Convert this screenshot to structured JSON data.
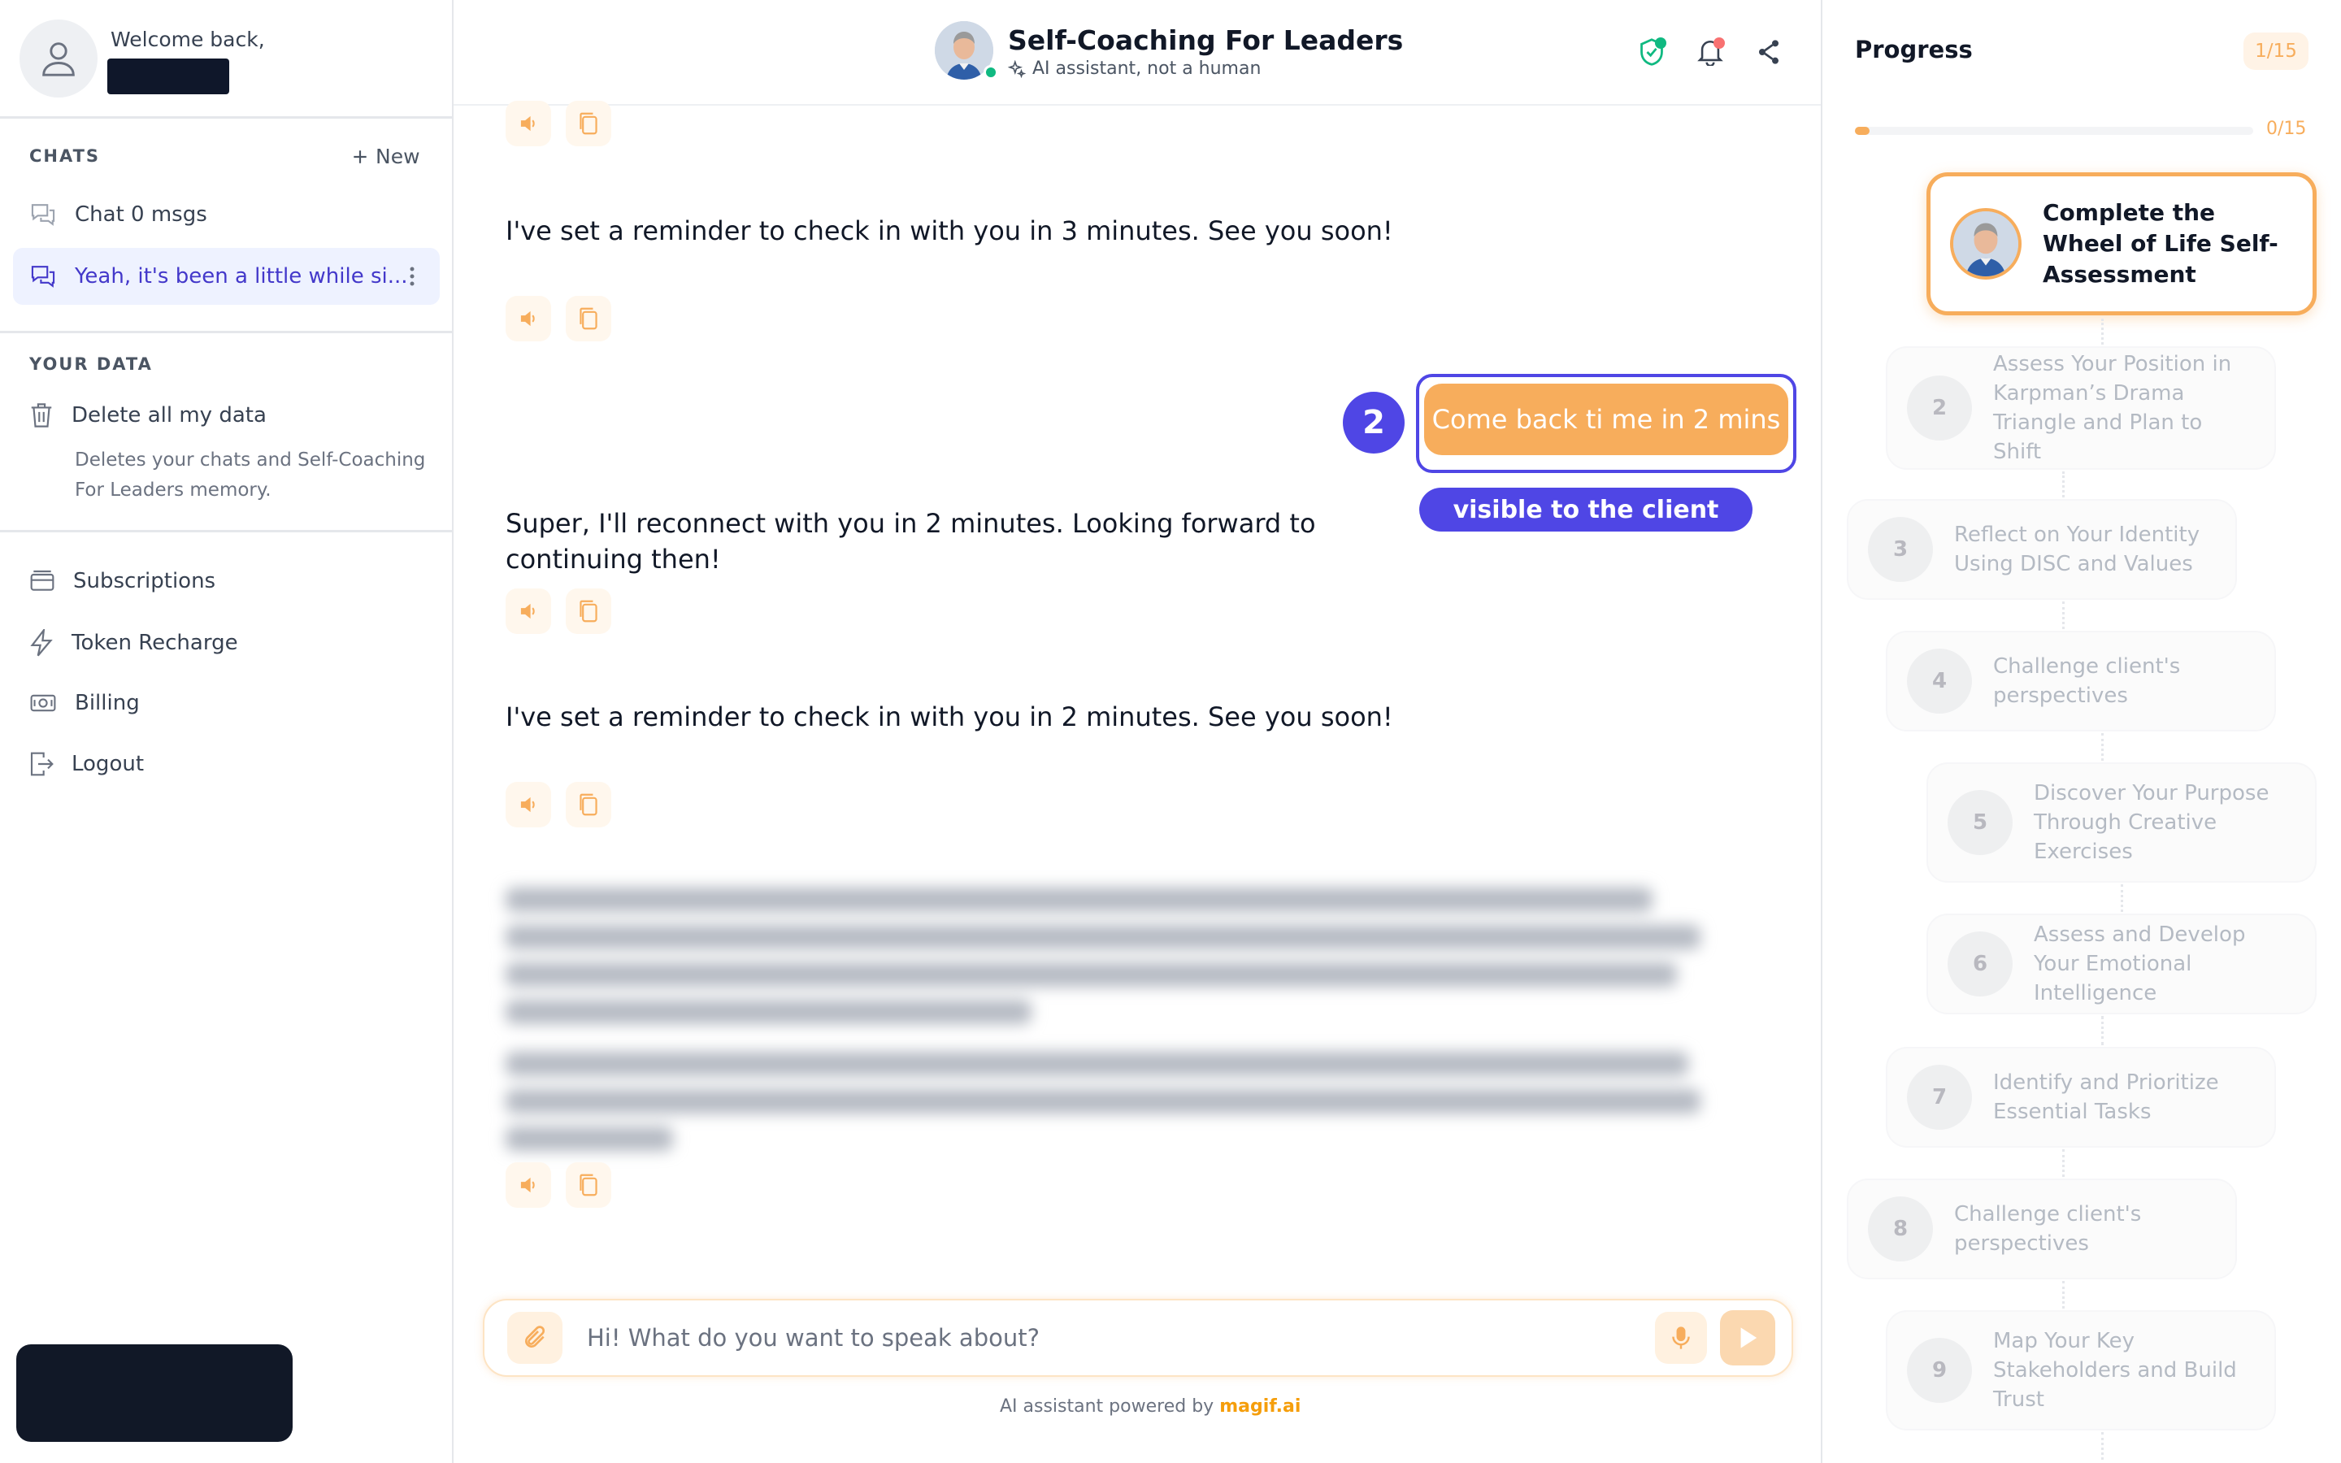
{
  "sidebar": {
    "welcome": "Welcome back,",
    "chats_label": "CHATS",
    "new_label": "New",
    "chats": [
      {
        "label": "Chat 0 msgs"
      },
      {
        "label": "Yeah, it's been a little while si..."
      }
    ],
    "your_data_label": "YOUR DATA",
    "delete_label": "Delete all my data",
    "delete_desc": "Deletes your chats and Self-Coaching For Leaders memory.",
    "menu": [
      {
        "label": "Subscriptions",
        "icon": "card-icon"
      },
      {
        "label": "Token Recharge",
        "icon": "bolt-icon"
      },
      {
        "label": "Billing",
        "icon": "banknote-icon"
      },
      {
        "label": "Logout",
        "icon": "logout-icon"
      }
    ]
  },
  "header": {
    "title": "Self-Coaching For Leaders",
    "subtitle": "AI assistant, not a human",
    "status_color": "#10b981"
  },
  "messages": [
    {
      "text": "I've set a reminder to check in with you in 3 minutes. See you soon!"
    },
    {
      "text": "Super, I'll reconnect with you in 2 minutes. Looking forward to continuing then!"
    },
    {
      "text": "I've set a reminder to check in with you in 2 minutes. See you soon!"
    }
  ],
  "user_message": "Come back ti me in 2 mins",
  "annotation": {
    "step_number": "2",
    "label": "visible to the client"
  },
  "composer": {
    "placeholder": "Hi! What do you want to speak about?"
  },
  "footer": {
    "powered_prefix": "AI assistant powered by",
    "powered_brand": "magif.ai"
  },
  "progress": {
    "title": "Progress",
    "badge": "1/15",
    "count": "0/15",
    "fraction": 0.02,
    "steps": [
      {
        "num": "",
        "label": "Complete the Wheel of Life Self-Assessment"
      },
      {
        "num": "2",
        "label": "Assess Your Position in Karpman’s Drama Triangle and Plan to Shift"
      },
      {
        "num": "3",
        "label": "Reflect on Your Identity Using DISC and Values"
      },
      {
        "num": "4",
        "label": "Challenge client's perspectives"
      },
      {
        "num": "5",
        "label": "Discover Your Purpose Through Creative Exercises"
      },
      {
        "num": "6",
        "label": "Assess and Develop Your Emotional Intelligence"
      },
      {
        "num": "7",
        "label": "Identify and Prioritize Essential Tasks"
      },
      {
        "num": "8",
        "label": "Challenge client's perspectives"
      },
      {
        "num": "9",
        "label": "Map Your Key Stakeholders and Build Trust"
      }
    ]
  },
  "colors": {
    "accent": "#f7ad5c",
    "annotation": "#4f46e5",
    "active_chat": "#4338ca"
  }
}
